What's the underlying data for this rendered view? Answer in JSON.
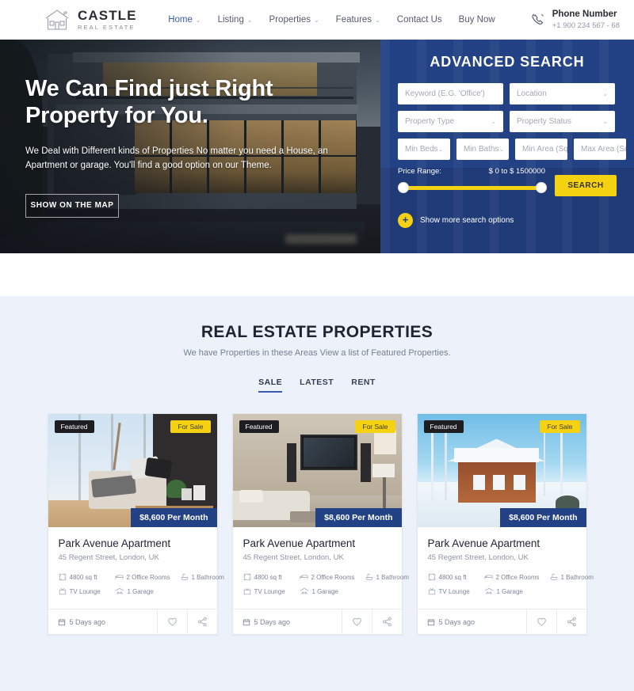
{
  "header": {
    "logo": {
      "title": "CASTLE",
      "subtitle": "REAL ESTATE",
      "icon": "house-logo-icon"
    },
    "nav": [
      {
        "label": "Home",
        "has_caret": true,
        "active": true
      },
      {
        "label": "Listing",
        "has_caret": true,
        "active": false
      },
      {
        "label": "Properties",
        "has_caret": true,
        "active": false
      },
      {
        "label": "Features",
        "has_caret": true,
        "active": false
      },
      {
        "label": "Contact Us",
        "has_caret": false,
        "active": false
      },
      {
        "label": "Buy Now",
        "has_caret": false,
        "active": false
      }
    ],
    "phone": {
      "label": "Phone Number",
      "number": "+1 900 234 567 - 68",
      "icon": "phone-icon"
    }
  },
  "hero": {
    "title_line1": "We Can Find just Right",
    "title_line2": "Property for You.",
    "subtitle_line1": "We Deal with Different kinds of Properties No matter you need a House, an Apartment or garage.",
    "subtitle_line2": "You'll find a good option on our Theme.",
    "button_label": "SHOW ON THE MAP"
  },
  "search": {
    "title": "ADVANCED SEARCH",
    "fields": {
      "keyword": {
        "placeholder": "Keyword (E.G. 'Office')",
        "value": ""
      },
      "location": {
        "placeholder": "Location",
        "value": ""
      },
      "property_type": {
        "placeholder": "Property Type",
        "value": ""
      },
      "property_status": {
        "placeholder": "Property Status",
        "value": ""
      },
      "min_beds": {
        "placeholder": "Min Beds",
        "value": ""
      },
      "min_baths": {
        "placeholder": "Min Baths",
        "value": ""
      },
      "min_area": {
        "placeholder": "Min Area (Sq",
        "value": ""
      },
      "max_area": {
        "placeholder": "Max Area (Sq",
        "value": ""
      }
    },
    "price_range": {
      "label": "Price Range:",
      "value": "$ 0 to $ 1500000",
      "min": 0,
      "max": 1500000
    },
    "search_button": "SEARCH",
    "more_options": {
      "label": "Show more search options",
      "icon": "plus-icon"
    }
  },
  "properties": {
    "title": "REAL ESTATE PROPERTIES",
    "subtitle": "We have Properties in these Areas View a list of Featured Properties.",
    "tabs": [
      {
        "label": "SALE",
        "active": true
      },
      {
        "label": "LATEST",
        "active": false
      },
      {
        "label": "RENT",
        "active": false
      }
    ],
    "cards": [
      {
        "featured_badge": "Featured",
        "status_badge": "For Sale",
        "price": "$8,600 Per Month",
        "title": "Park Avenue Apartment",
        "address": "45 Regent Street, London, UK",
        "features": [
          {
            "icon": "area-icon",
            "label": "4800 sq ft"
          },
          {
            "icon": "bed-icon",
            "label": "2 Office Rooms"
          },
          {
            "icon": "bath-icon",
            "label": "1 Bathroom"
          },
          {
            "icon": "tv-icon",
            "label": "TV Lounge"
          },
          {
            "icon": "car-icon",
            "label": "1 Garage"
          }
        ],
        "date": "5 Days ago",
        "date_icon": "calendar-icon",
        "actions": [
          {
            "icon": "heart-icon",
            "name": "favorite-button"
          },
          {
            "icon": "share-icon",
            "name": "share-button"
          }
        ]
      },
      {
        "featured_badge": "Featured",
        "status_badge": "For Sale",
        "price": "$8,600 Per Month",
        "title": "Park Avenue Apartment",
        "address": "45 Regent Street, London, UK",
        "features": [
          {
            "icon": "area-icon",
            "label": "4800 sq ft"
          },
          {
            "icon": "bed-icon",
            "label": "2 Office Rooms"
          },
          {
            "icon": "bath-icon",
            "label": "1 Bathroom"
          },
          {
            "icon": "tv-icon",
            "label": "TV Lounge"
          },
          {
            "icon": "car-icon",
            "label": "1 Garage"
          }
        ],
        "date": "5 Days ago",
        "date_icon": "calendar-icon",
        "actions": [
          {
            "icon": "heart-icon",
            "name": "favorite-button"
          },
          {
            "icon": "share-icon",
            "name": "share-button"
          }
        ]
      },
      {
        "featured_badge": "Featured",
        "status_badge": "For Sale",
        "price": "$8,600 Per Month",
        "title": "Park Avenue Apartment",
        "address": "45 Regent Street, London, UK",
        "features": [
          {
            "icon": "area-icon",
            "label": "4800 sq ft"
          },
          {
            "icon": "bed-icon",
            "label": "2 Office Rooms"
          },
          {
            "icon": "bath-icon",
            "label": "1 Bathroom"
          },
          {
            "icon": "tv-icon",
            "label": "TV Lounge"
          },
          {
            "icon": "car-icon",
            "label": "1 Garage"
          }
        ],
        "date": "5 Days ago",
        "date_icon": "calendar-icon",
        "actions": [
          {
            "icon": "heart-icon",
            "name": "favorite-button"
          },
          {
            "icon": "share-icon",
            "name": "share-button"
          }
        ]
      }
    ]
  },
  "colors": {
    "brand_blue": "#234285",
    "accent_yellow": "#F5D211",
    "section_bg": "#EDF1FA",
    "nav_active": "#3b5bb5",
    "badge_dark": "#1e1e22"
  }
}
